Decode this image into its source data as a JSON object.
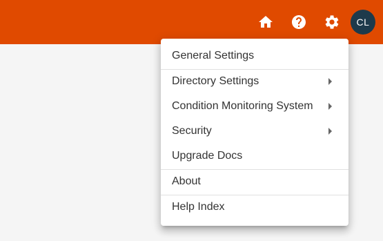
{
  "colors": {
    "appbar": "#e04a00",
    "avatar_bg": "#1d3a4b",
    "menu_text": "#333333"
  },
  "toolbar": {
    "home_icon": "home-icon",
    "help_icon": "help-icon",
    "settings_icon": "gear-icon",
    "avatar_initials": "CL"
  },
  "settings_menu": {
    "items": [
      {
        "label": "General Settings",
        "has_submenu": false
      },
      {
        "label": "Directory Settings",
        "has_submenu": true
      },
      {
        "label": "Condition Monitoring System",
        "has_submenu": true
      },
      {
        "label": "Security",
        "has_submenu": true
      },
      {
        "label": "Upgrade Docs",
        "has_submenu": false
      },
      {
        "label": "About",
        "has_submenu": false
      },
      {
        "label": "Help Index",
        "has_submenu": false
      }
    ]
  }
}
